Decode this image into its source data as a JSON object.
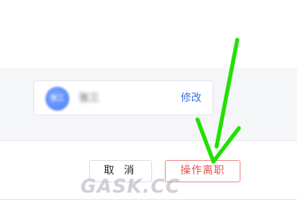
{
  "user_card": {
    "avatar_text": "张三",
    "name": "张三",
    "edit_label": "修改"
  },
  "dialog_footer": {
    "cancel_label": "取 消",
    "resign_label": "操作离职"
  },
  "watermark": "GASK.CC",
  "colors": {
    "link_blue": "#3a6fe0",
    "danger_red": "#e8524e",
    "arrow_green": "#22e000"
  }
}
